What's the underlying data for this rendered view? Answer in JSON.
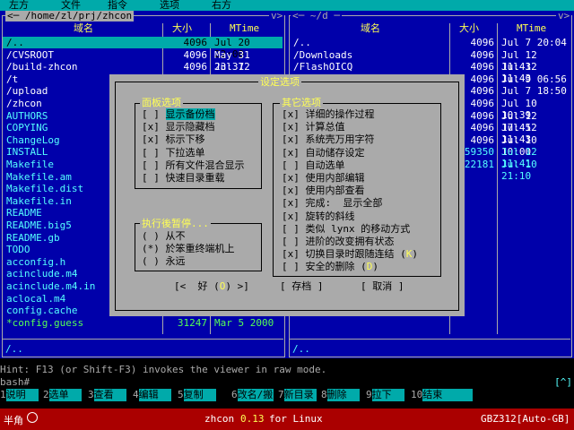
{
  "menubar": {
    "items": [
      "左方",
      "文件",
      "指令",
      "选项",
      "右方"
    ]
  },
  "left_panel": {
    "path": "<─ /home/zl/prj/zhcon",
    "corner_right": "v>",
    "col_name": "域名",
    "col_size": "大小",
    "col_time": "MTime",
    "rows": [
      {
        "name": "/..",
        "size": "4096",
        "time": "Jul 20 22:00"
      },
      {
        "name": "/CVSROOT",
        "size": "4096",
        "time": "May 31 23:37"
      },
      {
        "name": "/build-zhcon",
        "size": "4096",
        "time": "Jul 12 23:29"
      },
      {
        "name": "/t",
        "size": "",
        "time": ""
      },
      {
        "name": "/upload",
        "size": "",
        "time": ""
      },
      {
        "name": "/zhcon",
        "size": "",
        "time": ""
      },
      {
        "name": " AUTHORS",
        "size": "",
        "time": ""
      },
      {
        "name": " COPYING",
        "size": "",
        "time": ""
      },
      {
        "name": " ChangeLog",
        "size": "",
        "time": ""
      },
      {
        "name": " INSTALL",
        "size": "",
        "time": ""
      },
      {
        "name": " Makefile",
        "size": "",
        "time": ""
      },
      {
        "name": " Makefile.am",
        "size": "",
        "time": ""
      },
      {
        "name": " Makefile.dist",
        "size": "",
        "time": ""
      },
      {
        "name": " Makefile.in",
        "size": "",
        "time": ""
      },
      {
        "name": " README",
        "size": "",
        "time": ""
      },
      {
        "name": " README.big5",
        "size": "",
        "time": ""
      },
      {
        "name": " README.gb",
        "size": "",
        "time": ""
      },
      {
        "name": " TODO",
        "size": "",
        "time": ""
      },
      {
        "name": " acconfig.h",
        "size": "",
        "time": ""
      },
      {
        "name": " acinclude.m4",
        "size": "",
        "time": ""
      },
      {
        "name": " acinclude.m4.in",
        "size": "",
        "time": ""
      },
      {
        "name": " aclocal.m4",
        "size": "",
        "time": ""
      },
      {
        "name": " config.cache",
        "size": "",
        "time": ""
      },
      {
        "name": "*config.guess",
        "size": "31247",
        "time": "Mar  5  2000"
      }
    ],
    "status": "/.."
  },
  "right_panel": {
    "path": "<─ ~/d ─",
    "corner_right": "v>",
    "col_name": "域名",
    "col_size": "大小",
    "col_time": "MTime",
    "rows": [
      {
        "name": "/..",
        "size": "4096",
        "time": "Jul  7 20:04"
      },
      {
        "name": "/Downloads",
        "size": "4096",
        "time": "Jul 12 11:43"
      },
      {
        "name": "/FlashOICQ",
        "size": "4096",
        "time": "Jul 12 11:43"
      },
      {
        "name": "",
        "size": "4096",
        "time": "Jul  9 06:56"
      },
      {
        "name": "",
        "size": "4096",
        "time": "Jul  7 18:50"
      },
      {
        "name": "",
        "size": "4096",
        "time": "Jul 10 10:39"
      },
      {
        "name": "",
        "size": "4096",
        "time": "Jul 12 17:45"
      },
      {
        "name": "",
        "size": "4096",
        "time": "Jul 12 11:43"
      },
      {
        "name": "",
        "size": "4096",
        "time": "Jul 10 10:00"
      },
      {
        "name": "",
        "size": "59350",
        "time": "Jul 12 11:41"
      },
      {
        "name": "",
        "size": "22181",
        "time": "Jul 10 21:10"
      }
    ],
    "status": "/.."
  },
  "dialog": {
    "title": "设定选项",
    "panel_group_title": "面板选项",
    "panel_options": [
      {
        "mark": "[ ]",
        "label": "显示备份档"
      },
      {
        "mark": "[x]",
        "label": "显示隐藏档"
      },
      {
        "mark": "[x]",
        "label": "标示下移"
      },
      {
        "mark": "[ ]",
        "label": "下拉选单"
      },
      {
        "mark": "[ ]",
        "label": "所有文件混合显示"
      },
      {
        "mark": "[ ]",
        "label": "快速目录重载"
      }
    ],
    "pause_group_title": "执行後暂停...",
    "pause_options": [
      {
        "mark": "( )",
        "label": "从不"
      },
      {
        "mark": "(*)",
        "label": "於笨重终端机上"
      },
      {
        "mark": "( )",
        "label": "永远"
      }
    ],
    "other_group_title": "其它选项",
    "other_options": [
      {
        "mark": "[x]",
        "label": "详细的操作过程"
      },
      {
        "mark": "[x]",
        "label": "计算总值"
      },
      {
        "mark": "[x]",
        "label": "系统壳万用字符"
      },
      {
        "mark": "[x]",
        "label": "自动储存设定"
      },
      {
        "mark": "[ ]",
        "label": "自动选单"
      },
      {
        "mark": "[x]",
        "label": "使用内部编辑"
      },
      {
        "mark": "[x]",
        "label": "使用内部查看"
      },
      {
        "mark": "[x]",
        "label": "完成:  显示全部"
      },
      {
        "mark": "[x]",
        "label": "旋转的斜线"
      },
      {
        "mark": "[ ]",
        "label": "类似 lynx 的移动方式"
      },
      {
        "mark": "[ ]",
        "label": "进阶的改变拥有状态"
      },
      {
        "mark": "[x]",
        "label": "切换目录时跟随连结",
        "hotkey": "K"
      },
      {
        "mark": "[ ]",
        "label": "安全的删除",
        "hotkey": "D"
      }
    ],
    "ok_prefix": "[<  好 (",
    "ok_hotkey": "O",
    "ok_suffix": ") >]",
    "save_label": "[ 存档 ]",
    "cancel_label": "[ 取消 ]"
  },
  "hint": "Hint: F13 (or Shift-F3) invokes the viewer in raw mode.",
  "prompt": "bash#",
  "prompt_right": "[^]",
  "fkeys": [
    {
      "num": "1",
      "label": "说明"
    },
    {
      "num": "2",
      "label": "选单"
    },
    {
      "num": "3",
      "label": "查看"
    },
    {
      "num": "4",
      "label": "编辑"
    },
    {
      "num": "5",
      "label": "复制"
    },
    {
      "num": "6",
      "label": "改名/搬"
    },
    {
      "num": "7",
      "label": "新目录"
    },
    {
      "num": "8",
      "label": "删除"
    },
    {
      "num": "9",
      "label": "拉下"
    },
    {
      "num": "10",
      "label": "结束"
    }
  ],
  "taskbar": {
    "input_mode": "半角",
    "app_name": "zhcon",
    "version": "0.13",
    "platform": "for Linux",
    "encoding": "GBZ312[Auto-GB]"
  },
  "colors": {
    "panel_bg": "#0000aa",
    "menubar_bg": "#00aaaa",
    "dialog_bg": "#aaaaaa",
    "taskbar_bg": "#aa0000",
    "highlight": "#ffff55"
  }
}
